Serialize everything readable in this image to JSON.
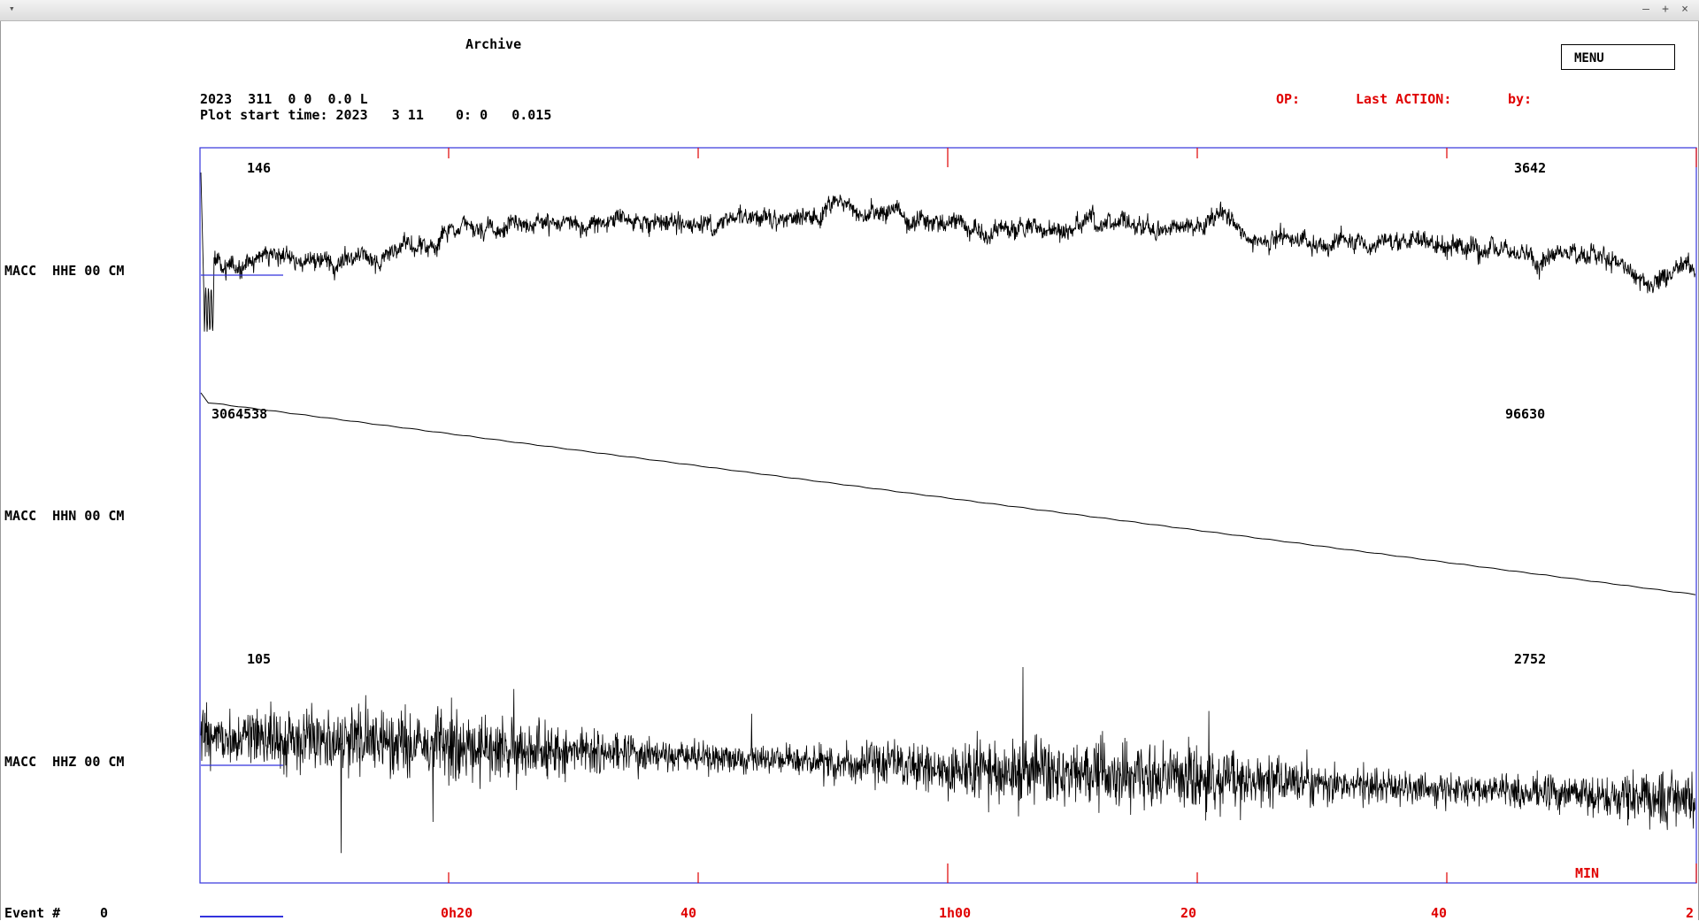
{
  "window": {
    "menu_glyph": "▾",
    "controls": [
      "–",
      "+",
      "×"
    ]
  },
  "header": {
    "title": "Archive",
    "menu_button": "MENU",
    "time_line": "2023  311  0 0  0.0 L",
    "plot_start_line": "Plot start time: 2023   3 11    0: 0   0.015",
    "op_label": "OP:",
    "last_action_label": "Last ACTION:",
    "by_label": "by:"
  },
  "traces": [
    {
      "label": "MACC  HHE 00 CM",
      "left_value": "146",
      "right_value": "3642"
    },
    {
      "label": "MACC  HHN 00 CM",
      "left_value": "3064538",
      "right_value": "96630"
    },
    {
      "label": "MACC  HHZ 00 CM",
      "left_value": "105",
      "right_value": "2752"
    }
  ],
  "time_axis": {
    "unit_label": "MIN",
    "tick_labels": [
      "0h20",
      "40",
      "1h00",
      "20",
      "40",
      "2"
    ]
  },
  "footer": {
    "event_label": "Event #",
    "event_value": "0"
  },
  "colors": {
    "frame": "#3333dd",
    "axis_text": "#e00000",
    "trace": "#000000"
  }
}
